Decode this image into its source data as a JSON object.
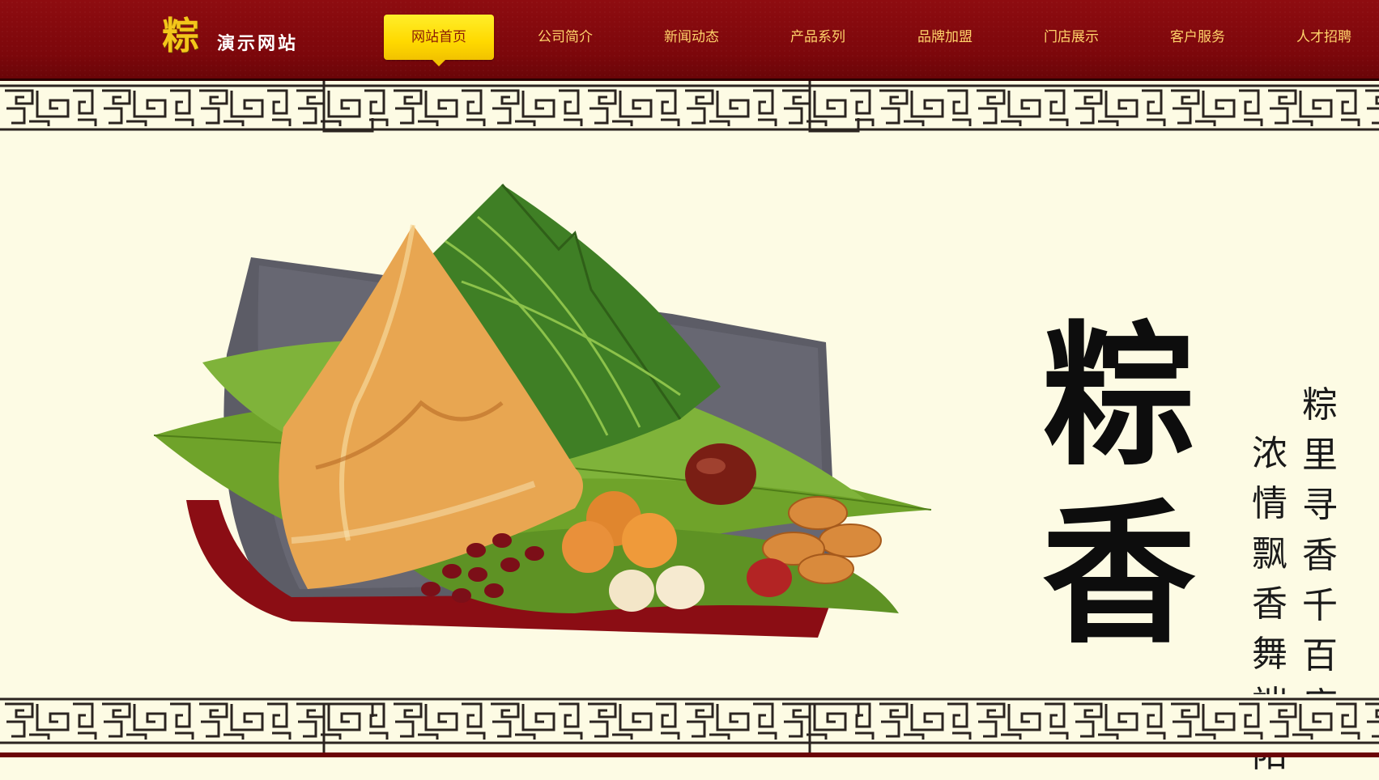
{
  "header": {
    "logo_char": "粽",
    "logo_text": "演示网站",
    "nav": [
      {
        "label": "网站首页",
        "active": true
      },
      {
        "label": "公司简介",
        "active": false
      },
      {
        "label": "新闻动态",
        "active": false
      },
      {
        "label": "产品系列",
        "active": false
      },
      {
        "label": "品牌加盟",
        "active": false
      },
      {
        "label": "门店展示",
        "active": false
      },
      {
        "label": "客户服务",
        "active": false
      },
      {
        "label": "人才招聘",
        "active": false
      }
    ]
  },
  "banner": {
    "title_chars": [
      "粽",
      "香"
    ],
    "poem_right": [
      "粽",
      "里",
      "寻",
      "香",
      "千",
      "百",
      "度"
    ],
    "poem_left": [
      "浓",
      "情",
      "飘",
      "香",
      "舞",
      "端",
      "阳"
    ]
  },
  "colors": {
    "header_red": "#7c070b",
    "nav_gold": "#ffd36b",
    "active_yellow": "#ffe000",
    "banner_cream": "#fdfbe4"
  }
}
